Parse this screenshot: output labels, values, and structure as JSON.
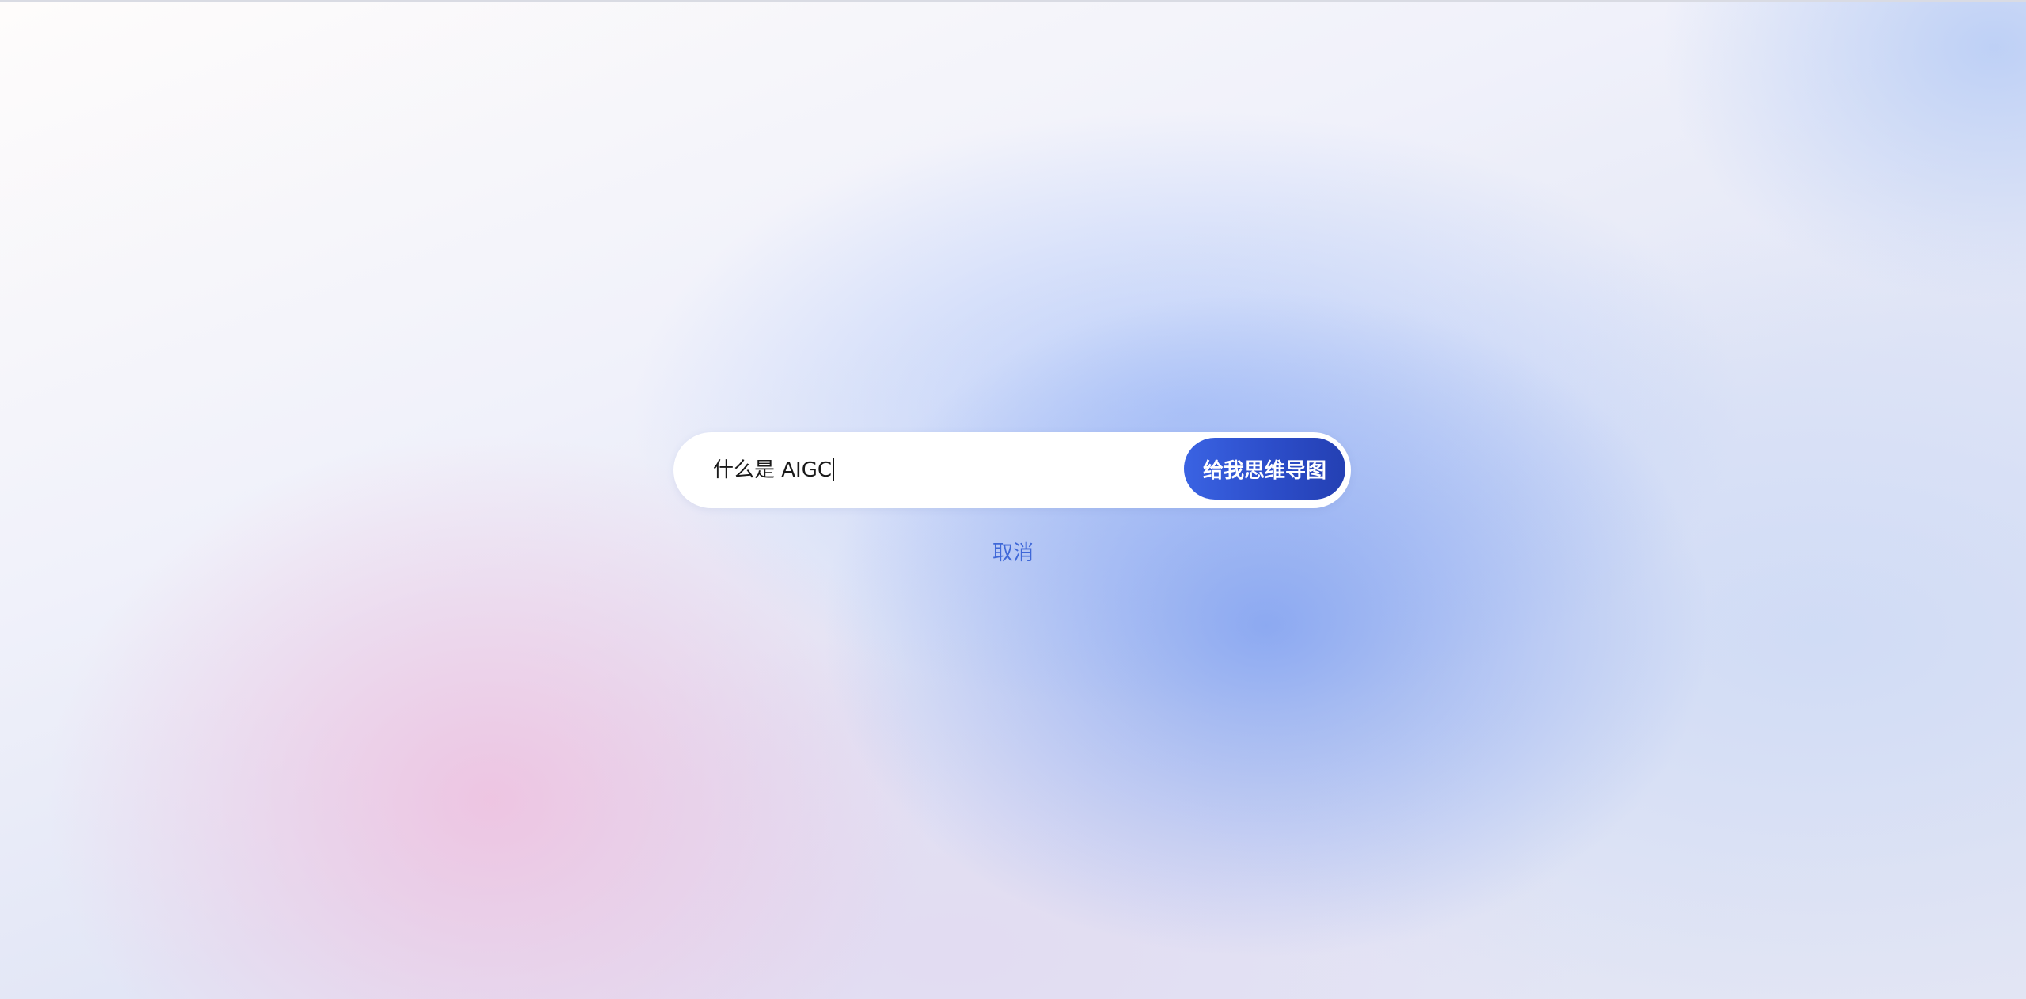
{
  "search": {
    "value": "什么是 AIGC",
    "submit_label": "给我思维导图"
  },
  "actions": {
    "cancel_label": "取消"
  },
  "colors": {
    "accent": "#2c4dc9",
    "link": "#3f68d8"
  }
}
